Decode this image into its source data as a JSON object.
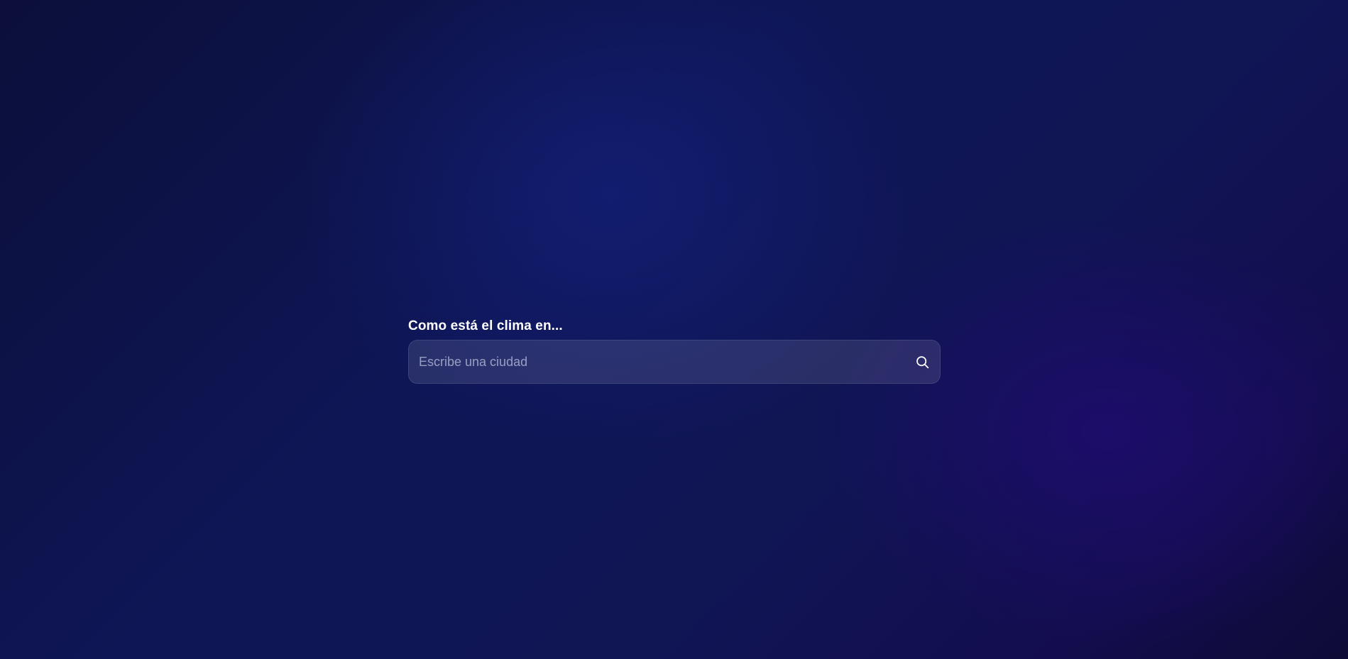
{
  "search": {
    "heading": "Como está el clima en...",
    "input_value": "",
    "placeholder": "Escribe una ciudad",
    "icon": "search-icon"
  },
  "colors": {
    "background_center": "#131e73",
    "background_corner": "#0c0f3a",
    "accent_glow": "#1e0c6e",
    "text": "#ffffff"
  }
}
